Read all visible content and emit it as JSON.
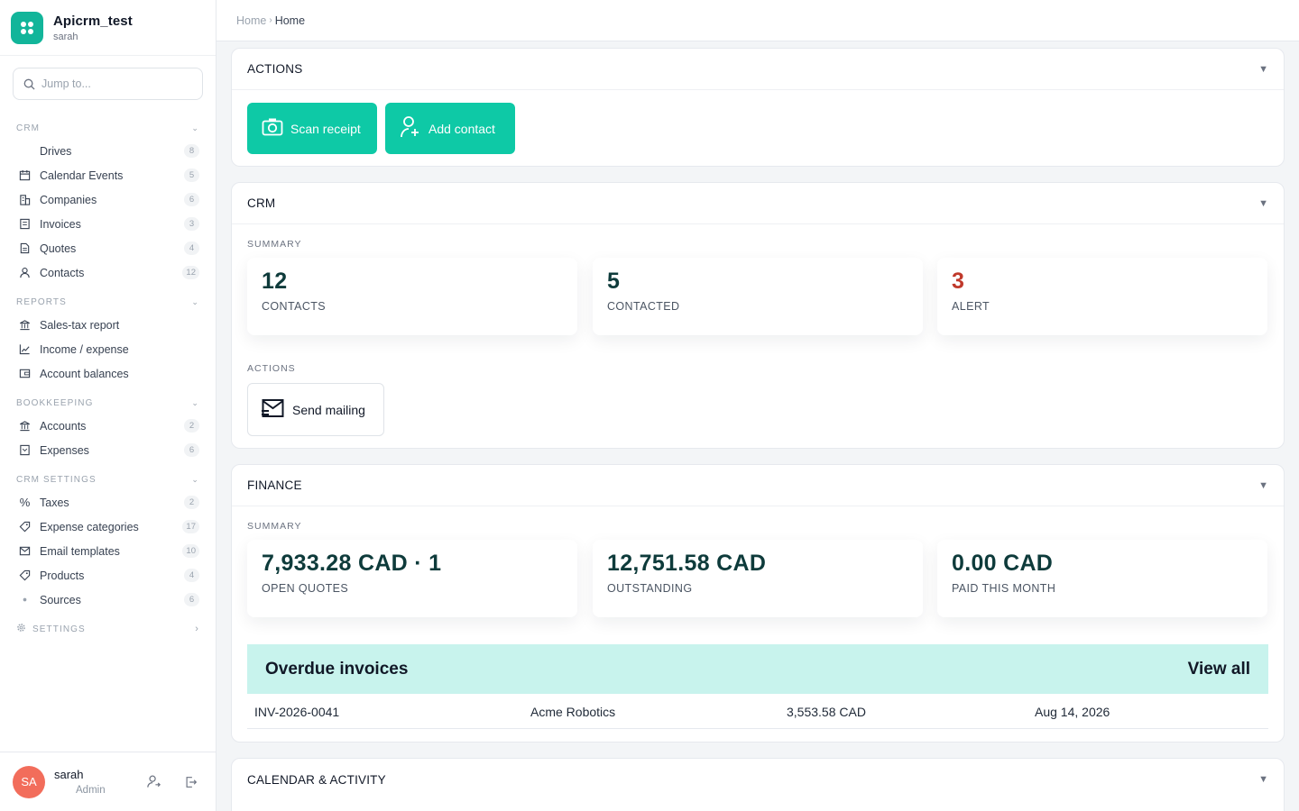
{
  "app": {
    "name": "Apicrm_test",
    "user": "sarah"
  },
  "search": {
    "placeholder": "Jump to..."
  },
  "sidebar": {
    "sections": [
      {
        "title": "CRM",
        "items": [
          {
            "label": "Drives",
            "count": "8",
            "icon": "none"
          },
          {
            "label": "Calendar Events",
            "count": "5",
            "icon": "calendar-icon"
          },
          {
            "label": "Companies",
            "count": "6",
            "icon": "building-icon"
          },
          {
            "label": "Invoices",
            "count": "3",
            "icon": "invoice-icon"
          },
          {
            "label": "Quotes",
            "count": "4",
            "icon": "document-icon"
          },
          {
            "label": "Contacts",
            "count": "12",
            "icon": "person-icon"
          }
        ]
      },
      {
        "title": "REPORTS",
        "items": [
          {
            "label": "Sales-tax report",
            "count": "",
            "icon": "bank-icon"
          },
          {
            "label": "Income / expense",
            "count": "",
            "icon": "line-chart-icon"
          },
          {
            "label": "Account balances",
            "count": "",
            "icon": "wallet-icon"
          }
        ]
      },
      {
        "title": "BOOKKEEPING",
        "items": [
          {
            "label": "Accounts",
            "count": "2",
            "icon": "bank-icon"
          },
          {
            "label": "Expenses",
            "count": "6",
            "icon": "receipt-icon"
          }
        ]
      },
      {
        "title": "CRM SETTINGS",
        "items": [
          {
            "label": "Taxes",
            "count": "2",
            "icon": "percent-icon"
          },
          {
            "label": "Expense categories",
            "count": "17",
            "icon": "tag-icon"
          },
          {
            "label": "Email templates",
            "count": "10",
            "icon": "mail-icon"
          },
          {
            "label": "Products",
            "count": "4",
            "icon": "tag-icon"
          },
          {
            "label": "Sources",
            "count": "6",
            "icon": "dot-icon"
          }
        ]
      }
    ],
    "settings_label": "SETTINGS"
  },
  "user_bar": {
    "initials": "SA",
    "name": "sarah",
    "role": "Admin"
  },
  "breadcrumb": {
    "parent": "Home",
    "current": "Home"
  },
  "actions_card": {
    "title": "ACTIONS",
    "buttons": [
      {
        "label": "Scan receipt"
      },
      {
        "label": "Add contact"
      }
    ]
  },
  "crm_card": {
    "title": "CRM",
    "summary_label": "SUMMARY",
    "stats": [
      {
        "value": "12",
        "caption": "CONTACTS"
      },
      {
        "value": "5",
        "caption": "CONTACTED"
      },
      {
        "value": "3",
        "caption": "ALERT",
        "color": "#c0392b"
      }
    ],
    "actions_label": "ACTIONS",
    "mailing_label": "Send mailing"
  },
  "finance_card": {
    "title": "FINANCE",
    "summary_label": "SUMMARY",
    "stats": [
      {
        "value": "7,933.28 CAD · 1",
        "caption": "OPEN QUOTES"
      },
      {
        "value": "12,751.58 CAD",
        "caption": "OUTSTANDING"
      },
      {
        "value": "0.00 CAD",
        "caption": "PAID THIS MONTH"
      }
    ],
    "overdue": {
      "title": "Overdue invoices",
      "view_all": "View all",
      "rows": [
        {
          "number": "INV-2026-0041",
          "client": "Acme Robotics",
          "amount": "3,553.58 CAD",
          "date": "Aug 14, 2026"
        }
      ]
    }
  },
  "calendar_card": {
    "title": "CALENDAR & ACTIVITY"
  },
  "colors": {
    "accent": "#0ec9a6",
    "brand": "#12b59a",
    "alert": "#c0392b",
    "overdue_bg": "#c8f3ed"
  }
}
